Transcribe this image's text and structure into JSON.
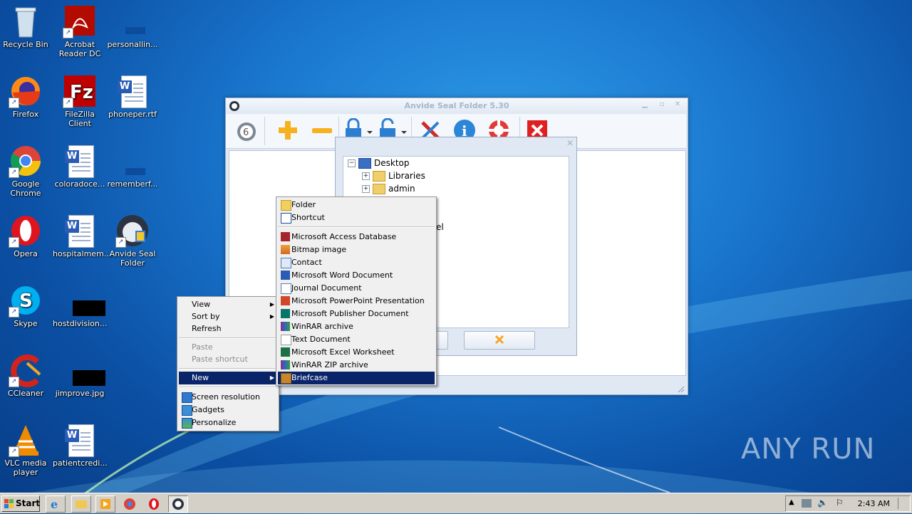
{
  "desktop": {
    "icons": [
      {
        "label": "Recycle Bin"
      },
      {
        "label": "Acrobat Reader DC"
      },
      {
        "label": "personallin..."
      },
      {
        "label": "Firefox"
      },
      {
        "label": "FileZilla Client"
      },
      {
        "label": "phoneper.rtf"
      },
      {
        "label": "Google Chrome"
      },
      {
        "label": "coloradoce..."
      },
      {
        "label": "rememberf..."
      },
      {
        "label": "Opera"
      },
      {
        "label": "hospitalmem..."
      },
      {
        "label": "Anvide Seal Folder"
      },
      {
        "label": "Skype"
      },
      {
        "label": "hostdivision..."
      },
      {
        "label": "CCleaner"
      },
      {
        "label": "jimprove.jpg"
      },
      {
        "label": "VLC media player"
      },
      {
        "label": "patientcredi..."
      }
    ]
  },
  "anvide": {
    "title": "Anvide Seal Folder 5.30",
    "dialog": {
      "tree": [
        {
          "label": "Desktop"
        },
        {
          "label": "Libraries"
        },
        {
          "label": "admin"
        },
        {
          "label": "el"
        }
      ]
    }
  },
  "context_menu": {
    "items": [
      {
        "label": "View"
      },
      {
        "label": "Sort by"
      },
      {
        "label": "Refresh"
      },
      {
        "label": "Paste"
      },
      {
        "label": "Paste shortcut"
      },
      {
        "label": "New"
      },
      {
        "label": "Screen resolution"
      },
      {
        "label": "Gadgets"
      },
      {
        "label": "Personalize"
      }
    ]
  },
  "new_menu": {
    "items": [
      {
        "label": "Folder"
      },
      {
        "label": "Shortcut"
      },
      {
        "label": "Microsoft Access Database"
      },
      {
        "label": "Bitmap image"
      },
      {
        "label": "Contact"
      },
      {
        "label": "Microsoft Word Document"
      },
      {
        "label": "Journal Document"
      },
      {
        "label": "Microsoft PowerPoint Presentation"
      },
      {
        "label": "Microsoft Publisher Document"
      },
      {
        "label": "WinRAR archive"
      },
      {
        "label": "Text Document"
      },
      {
        "label": "Microsoft Excel Worksheet"
      },
      {
        "label": "WinRAR ZIP archive"
      },
      {
        "label": "Briefcase"
      }
    ]
  },
  "taskbar": {
    "start_label": "Start",
    "clock": "2:43 AM"
  },
  "watermark": "ANY RUN"
}
